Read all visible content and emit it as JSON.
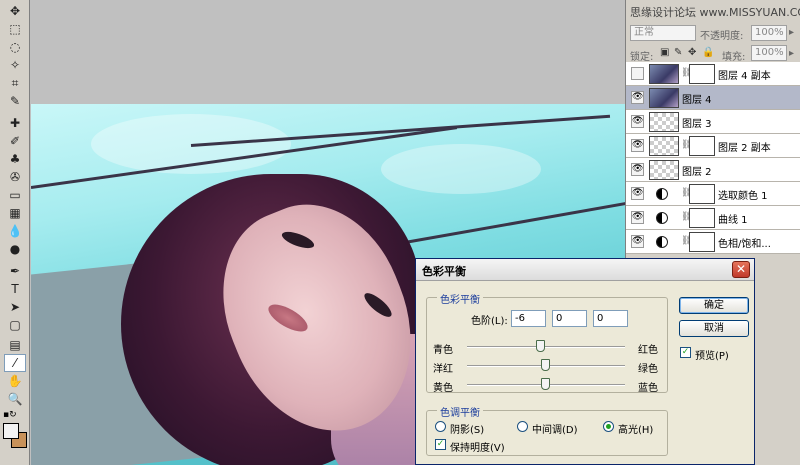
{
  "watermark": "思缘设计论坛 www.MISSYUAN.COM",
  "layers_panel": {
    "blend_mode": "正常",
    "opacity_label": "不透明度:",
    "opacity_value": "100%",
    "lock_label": "锁定:",
    "fill_label": "填充:",
    "fill_value": "100%",
    "layers": [
      {
        "name": "图层 4 副本",
        "visible": false,
        "selected": false
      },
      {
        "name": "图层 4",
        "visible": true,
        "selected": true
      },
      {
        "name": "图层 3",
        "visible": true,
        "selected": false
      },
      {
        "name": "图层 2 副本",
        "visible": true,
        "selected": false
      },
      {
        "name": "图层 2",
        "visible": true,
        "selected": false
      },
      {
        "name": "选取颜色 1",
        "visible": true,
        "selected": false
      },
      {
        "name": "曲线 1",
        "visible": true,
        "selected": false
      },
      {
        "name": "色相/饱和...",
        "visible": true,
        "selected": false
      }
    ]
  },
  "dialog": {
    "title": "色彩平衡",
    "close_glyph": "✕",
    "color_balance_group": "色彩平衡",
    "levels_label": "色阶(L):",
    "levels": [
      "-6",
      "0",
      "0"
    ],
    "sliders": [
      {
        "left": "青色",
        "right": "红色",
        "value": -6
      },
      {
        "left": "洋红",
        "right": "绿色",
        "value": 0
      },
      {
        "left": "黄色",
        "right": "蓝色",
        "value": 0
      }
    ],
    "tone_group": "色调平衡",
    "tone_options": [
      "阴影(S)",
      "中间调(D)",
      "高光(H)"
    ],
    "tone_selected": 2,
    "preserve_luminosity": "保持明度(V)",
    "ok": "确定",
    "cancel": "取消",
    "preview": "预览(P)"
  },
  "tools": [
    "move-icon",
    "marquee-icon",
    "lasso-icon",
    "magic-wand-icon",
    "crop-icon",
    "eyedropper-icon",
    "healing-icon",
    "brush-icon",
    "stamp-icon",
    "history-brush-icon",
    "eraser-icon",
    "gradient-icon",
    "blur-icon",
    "dodge-icon",
    "pen-icon",
    "type-icon",
    "path-select-icon",
    "shape-icon",
    "notes-icon",
    "eyedropper-active-icon",
    "hand-icon",
    "zoom-icon"
  ],
  "tool_glyphs": [
    "✥",
    "⬚",
    "◌",
    "✧",
    "⌗",
    "✎",
    "✚",
    "✐",
    "♣",
    "✇",
    "▭",
    "▦",
    "💧",
    "●",
    "✒",
    "T",
    "➤",
    "▢",
    "▤",
    "⁄",
    "✋",
    "🔍"
  ],
  "colors": {
    "foreground": "#f3f3f3",
    "background": "#c8925a"
  }
}
